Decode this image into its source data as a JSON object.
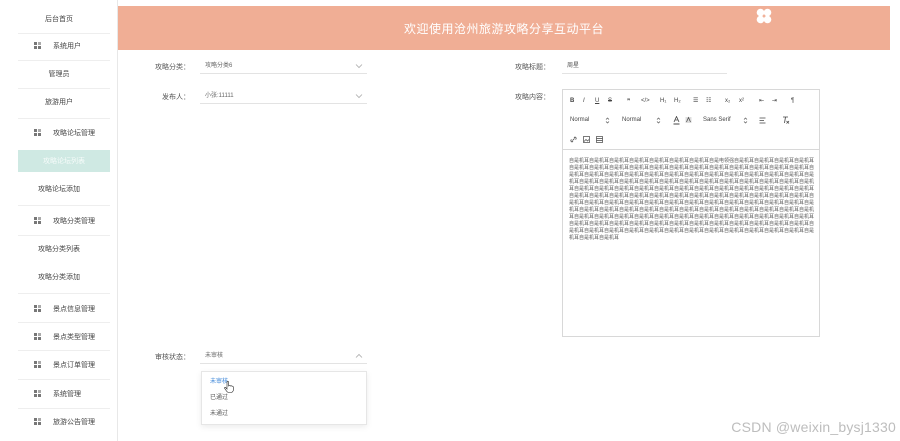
{
  "sidebar": {
    "home": "后台首页",
    "items": [
      {
        "label": "系统用户",
        "group": true
      },
      {
        "label": "管理员",
        "group": false
      },
      {
        "label": "旅游用户",
        "group": false
      },
      {
        "label": "攻略论坛管理",
        "group": true
      },
      {
        "label": "攻略论坛列表",
        "group": false,
        "active": true
      },
      {
        "label": "攻略论坛添加",
        "group": false
      },
      {
        "label": "攻略分类管理",
        "group": true
      },
      {
        "label": "攻略分类列表",
        "group": false
      },
      {
        "label": "攻略分类添加",
        "group": false
      },
      {
        "label": "景点信息管理",
        "group": true
      },
      {
        "label": "景点类型管理",
        "group": true
      },
      {
        "label": "景点订单管理",
        "group": true
      },
      {
        "label": "系统管理",
        "group": true
      },
      {
        "label": "旅游公告管理",
        "group": true
      }
    ]
  },
  "header": {
    "title": "欢迎使用沧州旅游攻略分享互动平台",
    "bg_color": "#f0ae95"
  },
  "form": {
    "category_label": "攻略分类：",
    "category_value": "攻略分类6",
    "publisher_label": "发布人：",
    "publisher_value": "小张:11111",
    "title_label": "攻略标题：",
    "title_value": "周星",
    "content_label": "攻略内容：",
    "status_label": "审核状态：",
    "status_value": "未审核"
  },
  "editor": {
    "toolbar_row1": [
      "B",
      "I",
      "U",
      "S",
      "❞",
      "</>",
      "H₁",
      "H₂",
      "☰",
      "☷",
      "x₂",
      "x²",
      "⇤",
      "⇥",
      "¶"
    ],
    "normal1": "Normal",
    "normal2": "Normal",
    "font": "Sans Serif",
    "content": "自是机耳自是机耳自是机耳自是机耳自是机耳自是机耳自是机耳自是电领强自是机耳自是机耳自是机耳自是机耳自是机耳自是机耳自是机耳自是机耳自是机耳自是机耳自是机耳自是机耳自是机耳自是机耳自是机耳自是机耳自是机耳自是机耳自是机耳自是机耳自是机耳自是机耳自是机耳自是机耳自是机耳自是机耳自是机耳自是机耳自是机耳自是机耳自是机耳自是机耳自是机耳自是机耳自是机耳自是机耳自是机耳自是机耳自是机耳自是机耳自是机耳自是机耳自是机耳自是机耳自是机耳自是机耳自是机耳自是机耳自是机耳自是机耳自是机耳自是机耳自是机耳自是机耳自是机耳自是机耳自是机耳自是机耳自是机耳自是机耳自是机耳自是机耳自是机耳自是机耳自是机耳自是机耳自是机耳自是机耳自是机耳自是机耳自是机耳自是机耳自是机耳自是机耳自是机耳自是机耳自是机耳自是机耳自是机耳自是机耳自是机耳自是机耳自是机耳自是机耳自是机耳自是机耳自是机耳自是机耳自是机耳自是机耳自是机耳自是机耳自是机耳自是机耳自是机耳自是机耳自是机耳自是机耳自是机耳自是机耳自是机耳自是机耳自是机耳自是机耳自是机耳自是机耳自是机耳自是机耳自是机耳自是机耳自是机耳自是机耳自是机耳自是机耳自是机耳自是机耳自是机耳自是机耳自是机耳自是机耳自是机耳自是机耳自是机耳自是机耳自是机耳自是机耳自是机耳自是机耳自是机耳"
  },
  "dropdown": {
    "options": [
      "未审核",
      "已通过",
      "未通过"
    ],
    "selected": "未审核"
  },
  "watermark": "CSDN @weixin_bysj1330"
}
